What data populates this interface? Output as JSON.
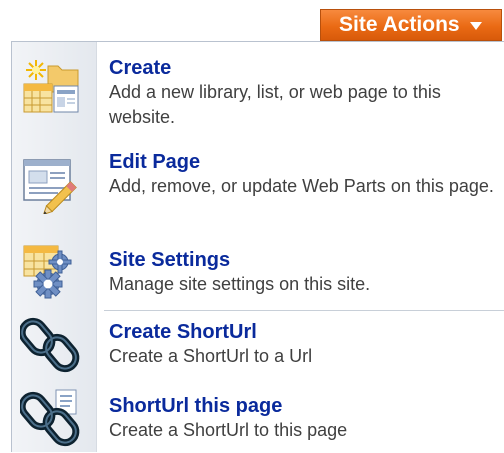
{
  "site_actions": {
    "label": "Site Actions"
  },
  "menu": {
    "items": [
      {
        "title": "Create",
        "description": "Add a new library, list, or web page to this website.",
        "icon": "create-icon"
      },
      {
        "title": "Edit Page",
        "description": "Add, remove, or update Web Parts on this page.",
        "icon": "edit-page-icon"
      },
      {
        "title": "Site Settings",
        "description": "Manage site settings on this site.",
        "icon": "site-settings-icon"
      },
      {
        "title": "Create ShortUrl",
        "description": "Create a ShortUrl to a Url",
        "icon": "chain-link-icon"
      },
      {
        "title": "ShortUrl this page",
        "description": "Create a ShortUrl to this page",
        "icon": "chain-link-page-icon"
      }
    ]
  },
  "colors": {
    "accent": "#ea6a14",
    "title_text": "#0a2a9c",
    "description_text": "#404040"
  }
}
